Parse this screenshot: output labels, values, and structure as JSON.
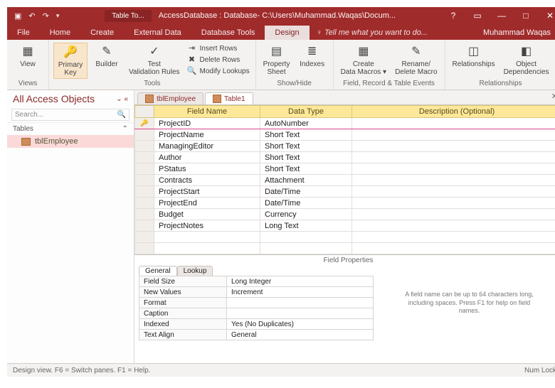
{
  "titlebar": {
    "tool_context": "Table To...",
    "db_title": "AccessDatabase : Database- C:\\Users\\Muhammad.Waqas\\Docum...",
    "help": "?"
  },
  "menu": {
    "tabs": [
      "File",
      "Home",
      "Create",
      "External Data",
      "Database Tools",
      "Design"
    ],
    "active_index": 5,
    "tell_me": "Tell me what you want to do...",
    "user": "Muhammad Waqas"
  },
  "ribbon": {
    "groups": [
      {
        "label": "Views",
        "buttons": [
          {
            "t": "View",
            "i": "▦"
          }
        ]
      },
      {
        "label": "Tools",
        "buttons": [
          {
            "t": "Primary Key",
            "i": "🔑",
            "sel": true
          },
          {
            "t": "Builder",
            "i": "✎"
          },
          {
            "t": "Test Validation Rules",
            "i": "✓"
          }
        ],
        "stack": [
          {
            "t": "Insert Rows",
            "i": "⇥"
          },
          {
            "t": "Delete Rows",
            "i": "✖"
          },
          {
            "t": "Modify Lookups",
            "i": "🔍"
          }
        ]
      },
      {
        "label": "Show/Hide",
        "buttons": [
          {
            "t": "Property Sheet",
            "i": "▤"
          },
          {
            "t": "Indexes",
            "i": "≣"
          }
        ]
      },
      {
        "label": "Field, Record & Table Events",
        "buttons": [
          {
            "t": "Create Data Macros ▾",
            "i": "▦"
          },
          {
            "t": "Rename/ Delete Macro",
            "i": "✎"
          }
        ]
      },
      {
        "label": "Relationships",
        "buttons": [
          {
            "t": "Relationships",
            "i": "◫"
          },
          {
            "t": "Object Dependencies",
            "i": "◧"
          }
        ]
      }
    ]
  },
  "nav": {
    "title": "All Access Objects",
    "search_placeholder": "Search...",
    "section": "Tables",
    "items": [
      {
        "label": "tblEmployee"
      }
    ]
  },
  "doc_tabs": [
    {
      "label": "tblEmployee",
      "active": false
    },
    {
      "label": "Table1",
      "active": true
    }
  ],
  "columns": [
    "Field Name",
    "Data Type",
    "Description (Optional)"
  ],
  "rows": [
    {
      "pk": true,
      "name": "ProjectID",
      "type": "AutoNumber"
    },
    {
      "name": "ProjectName",
      "type": "Short Text"
    },
    {
      "name": "ManagingEditor",
      "type": "Short Text"
    },
    {
      "name": "Author",
      "type": "Short Text"
    },
    {
      "name": "PStatus",
      "type": "Short Text"
    },
    {
      "name": "Contracts",
      "type": "Attachment"
    },
    {
      "name": "ProjectStart",
      "type": "Date/Time"
    },
    {
      "name": "ProjectEnd",
      "type": "Date/Time"
    },
    {
      "name": "Budget",
      "type": "Currency"
    },
    {
      "name": "ProjectNotes",
      "type": "Long Text"
    }
  ],
  "field_props": {
    "heading": "Field Properties",
    "tabs": [
      "General",
      "Lookup"
    ],
    "rows": [
      {
        "k": "Field Size",
        "v": "Long Integer"
      },
      {
        "k": "New Values",
        "v": "Increment"
      },
      {
        "k": "Format",
        "v": ""
      },
      {
        "k": "Caption",
        "v": ""
      },
      {
        "k": "Indexed",
        "v": "Yes (No Duplicates)"
      },
      {
        "k": "Text Align",
        "v": "General"
      }
    ],
    "hint": "A field name can be up to 64 characters long, including spaces. Press F1 for help on field names."
  },
  "status": {
    "left": "Design view.  F6 = Switch panes.  F1 = Help.",
    "right": "Num Lock"
  }
}
